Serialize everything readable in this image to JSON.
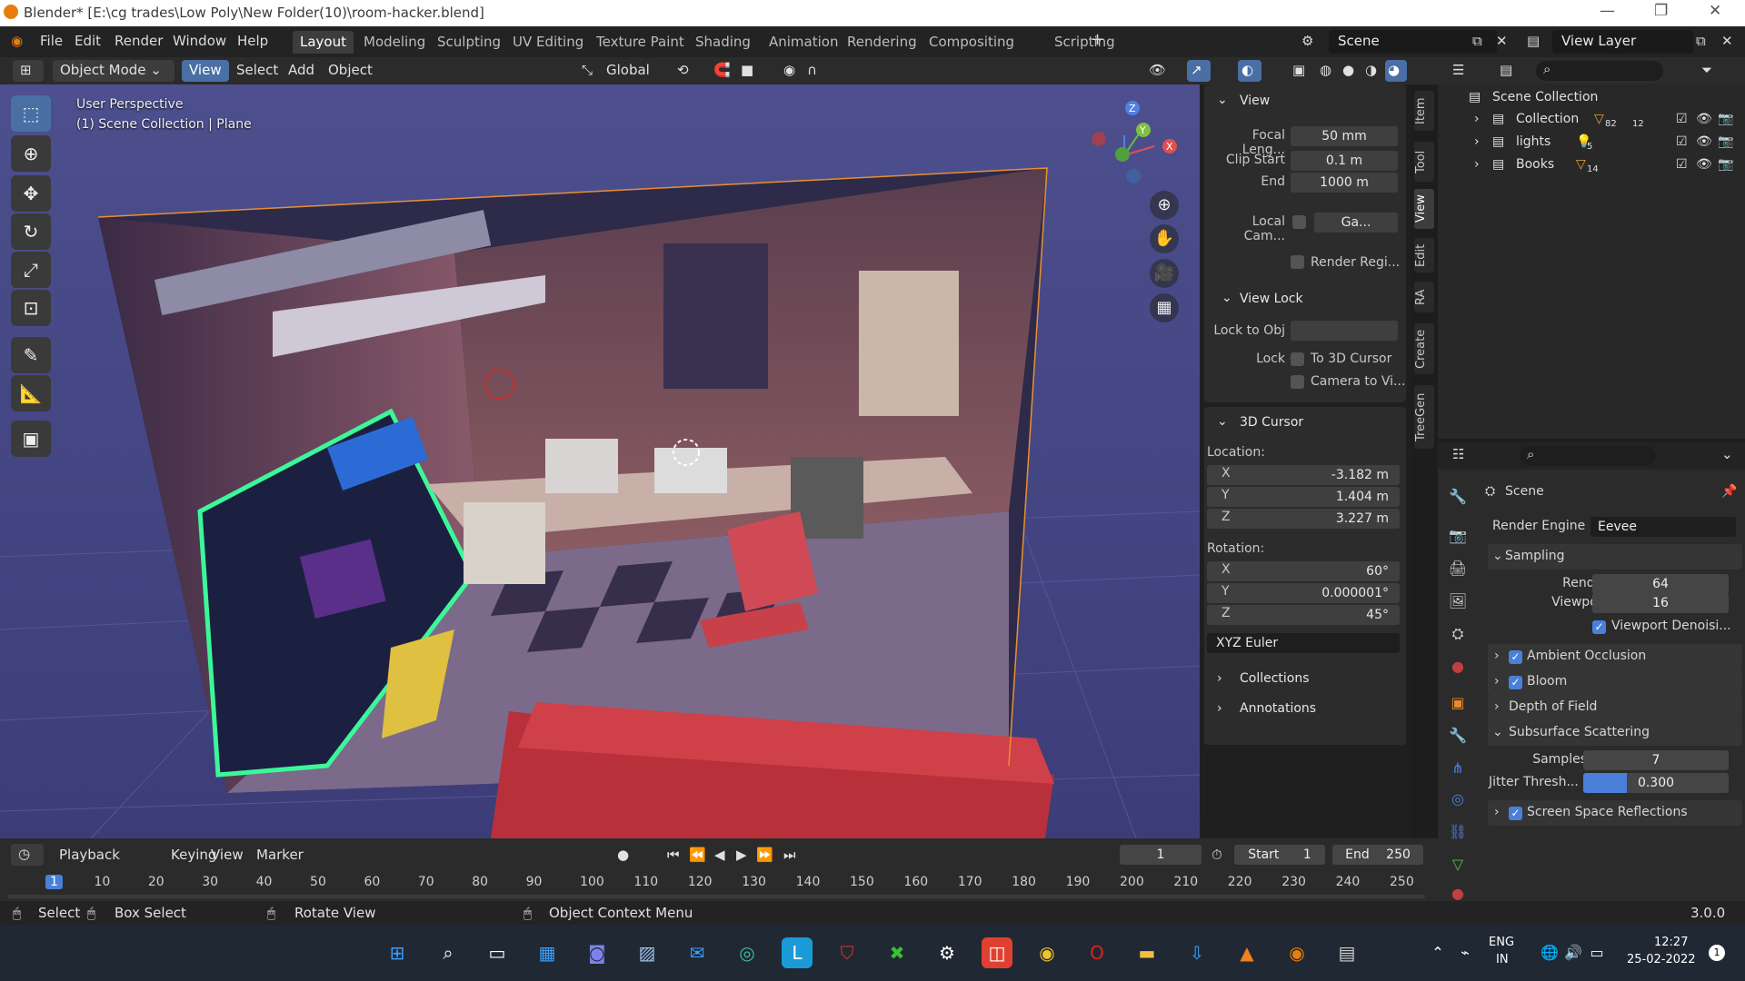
{
  "window": {
    "title": "Blender* [E:\\cg trades\\Low Poly\\New Folder(10)\\room-hacker.blend]"
  },
  "menu": [
    "File",
    "Edit",
    "Render",
    "Window",
    "Help"
  ],
  "workspaces": [
    "Layout",
    "Modeling",
    "Sculpting",
    "UV Editing",
    "Texture Paint",
    "Shading",
    "Animation",
    "Rendering",
    "Compositing",
    "Scripting"
  ],
  "scene_name": "Scene",
  "view_layer": "View Layer",
  "viewport_header": {
    "mode": "Object Mode",
    "view": "View",
    "select": "Select",
    "add": "Add",
    "object": "Object",
    "orientation": "Global"
  },
  "viewport": {
    "perspective": "User Perspective",
    "collection_info": "(1) Scene Collection | Plane"
  },
  "npanel": {
    "view_title": "View",
    "focal_label": "Focal Leng...",
    "focal_value": "50 mm",
    "clip_start_label": "Clip Start",
    "clip_start_value": "0.1 m",
    "clip_end_label": "End",
    "clip_end_value": "1000 m",
    "local_cam_label": "Local Cam...",
    "local_cam_value": "Ga...",
    "render_region": "Render Regi...",
    "view_lock_title": "View Lock",
    "lock_to_obj": "Lock to Obj",
    "lock_label": "Lock",
    "to_3d_cursor": "To 3D Cursor",
    "camera_to_view": "Camera to Vi...",
    "cursor_title": "3D Cursor",
    "location_label": "Location:",
    "loc_x": "-3.182 m",
    "loc_y": "1.404 m",
    "loc_z": "3.227 m",
    "rotation_label": "Rotation:",
    "rot_x": "60°",
    "rot_y": "0.000001°",
    "rot_z": "45°",
    "rotation_mode": "XYZ Euler",
    "collections": "Collections",
    "annotations": "Annotations",
    "x": "X",
    "y": "Y",
    "z": "Z"
  },
  "side_tabs": [
    "Item",
    "Tool",
    "View",
    "Edit",
    "RA",
    "Create",
    "TreeGen"
  ],
  "outliner": {
    "root": "Scene Collection",
    "items": [
      {
        "name": "Collection",
        "badge": "82",
        "badge2": "12"
      },
      {
        "name": "lights",
        "badge": "5"
      },
      {
        "name": "Books",
        "badge": "14"
      }
    ]
  },
  "properties": {
    "scene_label": "Scene",
    "render_engine_label": "Render Engine",
    "render_engine_value": "Eevee",
    "sampling": "Sampling",
    "render_label": "Render",
    "render_value": "64",
    "viewport_label": "Viewport",
    "viewport_value": "16",
    "viewport_denoising": "Viewport Denoisi...",
    "ambient_occlusion": "Ambient Occlusion",
    "bloom": "Bloom",
    "depth_of_field": "Depth of Field",
    "subsurface": "Subsurface Scattering",
    "samples_label": "Samples",
    "samples_value": "7",
    "jitter_label": "Jitter Thresh...",
    "jitter_value": "0.300",
    "jitter_fraction": 0.3,
    "ssr": "Screen Space Reflections"
  },
  "timeline": {
    "playback": "Playback",
    "keying": "Keying",
    "view": "View",
    "marker": "Marker",
    "current_frame": "1",
    "start_label": "Start",
    "start_value": "1",
    "end_label": "End",
    "end_value": "250",
    "ticks": [
      "1",
      "10",
      "20",
      "30",
      "40",
      "50",
      "60",
      "70",
      "80",
      "90",
      "100",
      "110",
      "120",
      "130",
      "140",
      "150",
      "160",
      "170",
      "180",
      "190",
      "200",
      "210",
      "220",
      "230",
      "240",
      "250"
    ]
  },
  "status": {
    "select": "Select",
    "box_select": "Box Select",
    "rotate_view": "Rotate View",
    "context_menu": "Object Context Menu",
    "version": "3.0.0"
  },
  "taskbar": {
    "lang1": "ENG",
    "lang2": "IN",
    "time": "12:27",
    "date": "25-02-2022",
    "notif": "1"
  },
  "colors": {
    "accent": "#4a80d9",
    "selected_blue": "#4a6fa5",
    "blender_orange": "#e87d0d"
  }
}
